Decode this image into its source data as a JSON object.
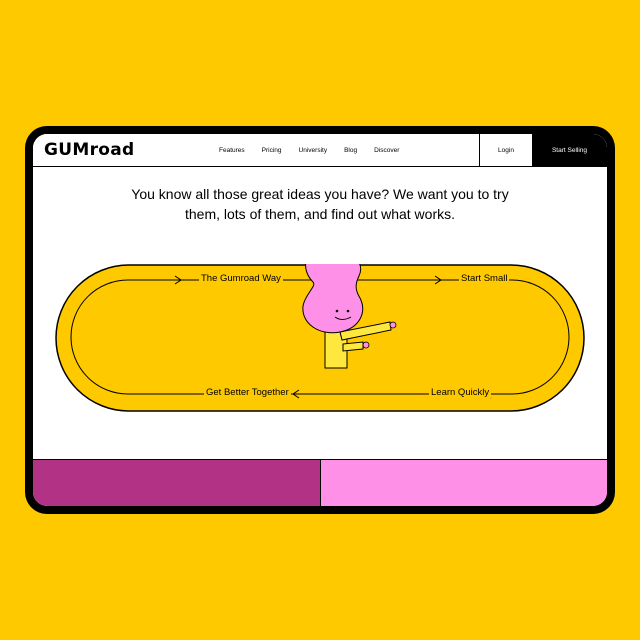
{
  "nav": {
    "logo": "GUMroad",
    "links": [
      "Features",
      "Pricing",
      "University",
      "Blog",
      "Discover"
    ],
    "login": "Login",
    "start_selling": "Start Selling"
  },
  "headline": {
    "line1": "You know all those great ideas you have? We want you to try",
    "line2": "them, lots of them, and find out what works."
  },
  "loop": {
    "step1": "The Gumroad Way",
    "step2": "Start Small",
    "step3": "Learn Quickly",
    "step4": "Get Better Together"
  },
  "colors": {
    "background": "#FFC900",
    "pink": "#FF90E8",
    "magenta": "#B23386",
    "black": "#000000"
  }
}
